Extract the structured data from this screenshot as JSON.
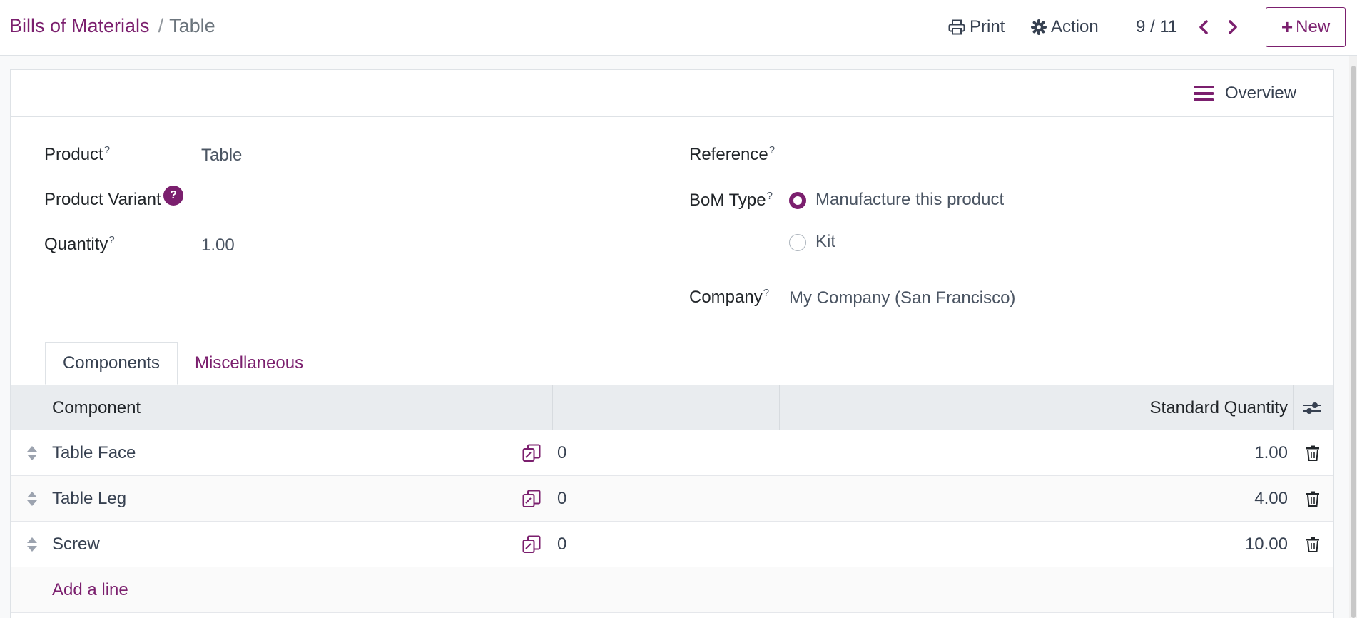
{
  "breadcrumb": {
    "parent": "Bills of Materials",
    "separator": "/",
    "current": "Table"
  },
  "toolbar": {
    "print_label": "Print",
    "action_label": "Action",
    "new_label": "New"
  },
  "pager": {
    "value": "9 / 11"
  },
  "button_box": {
    "overview_label": "Overview"
  },
  "form": {
    "product_label": "Product",
    "product_value": "Table",
    "variant_label": "Product Variant",
    "variant_help": "?",
    "quantity_label": "Quantity",
    "quantity_value": "1.00",
    "reference_label": "Reference",
    "bom_type_label": "BoM Type",
    "bom_type_options": [
      "Manufacture this product",
      "Kit"
    ],
    "bom_type_selected": "Manufacture this product",
    "company_label": "Company",
    "company_value": "My Company (San Francisco)",
    "help_marker": "?"
  },
  "tabs": [
    {
      "label": "Components",
      "active": true
    },
    {
      "label": "Miscellaneous",
      "active": false
    }
  ],
  "components_table": {
    "columns": [
      "Component",
      "Standard Quantity"
    ],
    "rows": [
      {
        "component": "Table Face",
        "count": "0",
        "quantity": "1.00"
      },
      {
        "component": "Table Leg",
        "count": "0",
        "quantity": "4.00"
      },
      {
        "component": "Screw",
        "count": "0",
        "quantity": "10.00"
      }
    ],
    "add_line_label": "Add a line"
  },
  "colors": {
    "brand": "#7b1f6e",
    "header_bg": "#e9ecef",
    "border": "#dee2e6"
  },
  "icons": [
    "print-icon",
    "gear-icon",
    "chevron-left-icon",
    "chevron-right-icon",
    "plus-icon",
    "list-icon",
    "drag-handle-icon",
    "copy-icon",
    "trash-icon",
    "column-settings-icon"
  ]
}
